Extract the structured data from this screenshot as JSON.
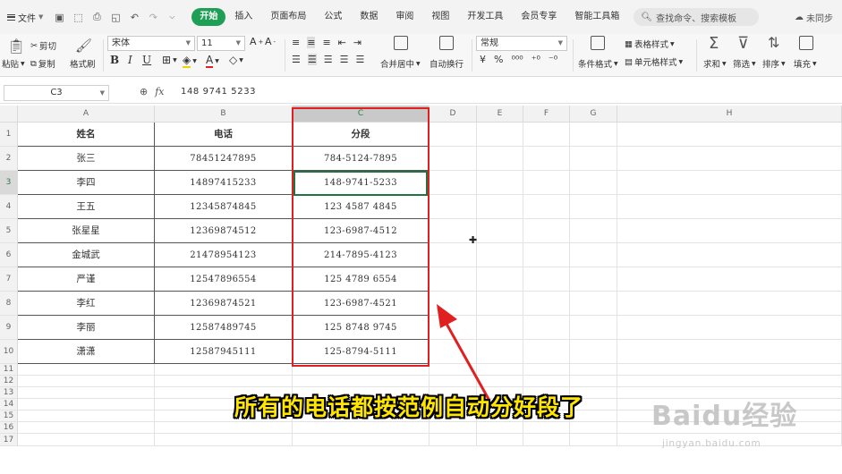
{
  "menu": {
    "file_label": "文件",
    "tabs": [
      "开始",
      "插入",
      "页面布局",
      "公式",
      "数据",
      "审阅",
      "视图",
      "开发工具",
      "会员专享",
      "智能工具箱"
    ],
    "active_tab": "开始",
    "search_placeholder": "查找命令、搜索模板",
    "cloud_label": "未同步"
  },
  "toolbar": {
    "paste": "粘贴",
    "cut": "剪切",
    "copy": "复制",
    "format_painter": "格式刷",
    "font_name": "宋体",
    "font_size": "11",
    "merge_center": "合并居中",
    "auto_wrap": "自动换行",
    "number_format": "常规",
    "conditional_format": "条件格式",
    "table_style": "表格样式",
    "cell_style": "单元格样式",
    "sum": "求和",
    "filter": "筛选",
    "sort": "排序",
    "fill": "填充",
    "percent_symbol": "%",
    "currency_symbol": "¥"
  },
  "formula_bar": {
    "cell_ref": "C3",
    "fx_label": "fx",
    "value": "148 9741 5233"
  },
  "grid": {
    "columns": [
      "A",
      "B",
      "C",
      "D",
      "E",
      "F",
      "G",
      "H"
    ],
    "rows": [
      "1",
      "2",
      "3",
      "4",
      "5",
      "6",
      "7",
      "8",
      "9",
      "10",
      "11",
      "12",
      "13",
      "14",
      "15",
      "16",
      "17"
    ],
    "selected_column": "C",
    "selected_row": "3",
    "headers": [
      "姓名",
      "电话",
      "分段"
    ],
    "data": [
      [
        "张三",
        "78451247895",
        "784-5124-7895"
      ],
      [
        "李四",
        "14897415233",
        "148-9741-5233"
      ],
      [
        "王五",
        "12345874845",
        "123 4587 4845"
      ],
      [
        "张星星",
        "12369874512",
        "123-6987-4512"
      ],
      [
        "金城武",
        "21478954123",
        "214-7895-4123"
      ],
      [
        "严谨",
        "12547896554",
        "125 4789 6554"
      ],
      [
        "李红",
        "12369874521",
        "123-6987-4521"
      ],
      [
        "李丽",
        "12587489745",
        "125 8748 9745"
      ],
      [
        "潇潇",
        "12587945111",
        "125-8794-5111"
      ]
    ]
  },
  "annotation": {
    "caption": "所有的电话都按范例自动分好段了",
    "watermark_logo": "Baidu经验",
    "watermark_site": "jingyan.baidu.com",
    "highlight_color": "#e02020"
  }
}
